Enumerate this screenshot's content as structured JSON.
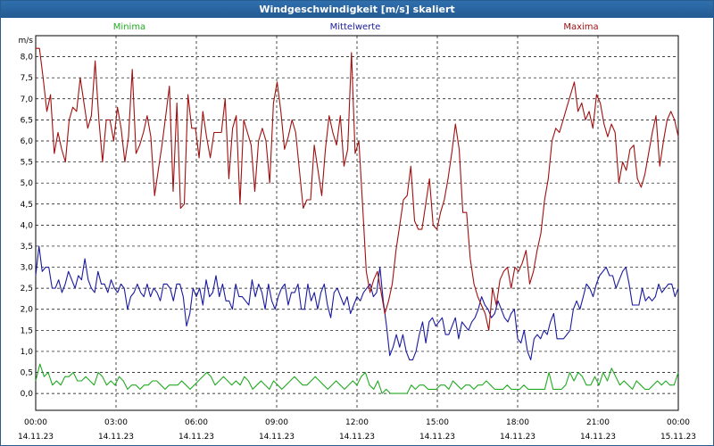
{
  "window": {
    "title": "Windgeschwindigkeit [m/s] skaliert"
  },
  "chart_data": {
    "type": "line",
    "title": "Windgeschwindigkeit [m/s] skaliert",
    "ylabel": "m/s",
    "ylim": [
      -0.4,
      8.5
    ],
    "xlim": [
      0,
      24
    ],
    "yticks": [
      "0,0",
      "0,5",
      "1,0",
      "1,5",
      "2,0",
      "2,5",
      "3,0",
      "3,5",
      "4,0",
      "4,5",
      "5,0",
      "5,5",
      "6,0",
      "6,5",
      "7,0",
      "7,5",
      "8,0"
    ],
    "xticks": [
      {
        "time": "00:00",
        "date": "14.11.23"
      },
      {
        "time": "03:00",
        "date": "14.11.23"
      },
      {
        "time": "06:00",
        "date": "14.11.23"
      },
      {
        "time": "09:00",
        "date": "14.11.23"
      },
      {
        "time": "12:00",
        "date": "14.11.23"
      },
      {
        "time": "15:00",
        "date": "14.11.23"
      },
      {
        "time": "18:00",
        "date": "14.11.23"
      },
      {
        "time": "21:00",
        "date": "14.11.23"
      },
      {
        "time": "00:00",
        "date": "15.11.23"
      }
    ],
    "grid": true,
    "legend_position": "top",
    "series": [
      {
        "name": "Minima",
        "color": "#22aa22",
        "values": [
          0.3,
          0.7,
          0.4,
          0.5,
          0.2,
          0.3,
          0.2,
          0.4,
          0.4,
          0.5,
          0.3,
          0.3,
          0.4,
          0.3,
          0.2,
          0.5,
          0.4,
          0.2,
          0.3,
          0.2,
          0.4,
          0.3,
          0.1,
          0.2,
          0.2,
          0.1,
          0.2,
          0.2,
          0.3,
          0.3,
          0.2,
          0.1,
          0.2,
          0.2,
          0.2,
          0.3,
          0.2,
          0.1,
          0.2,
          0.3,
          0.4,
          0.5,
          0.4,
          0.2,
          0.3,
          0.4,
          0.3,
          0.2,
          0.3,
          0.2,
          0.4,
          0.3,
          0.1,
          0.2,
          0.3,
          0.2,
          0.1,
          0.3,
          0.2,
          0.1,
          0.2,
          0.3,
          0.4,
          0.3,
          0.2,
          0.2,
          0.3,
          0.4,
          0.3,
          0.2,
          0.1,
          0.2,
          0.3,
          0.2,
          0.1,
          0.2,
          0.3,
          0.2,
          0.4,
          0.5,
          0.2,
          0.1,
          0.3,
          0.0,
          0.1,
          0.0,
          0.0,
          0.0,
          0.0,
          0.0,
          0.2,
          0.1,
          0.2,
          0.2,
          0.1,
          0.1,
          0.1,
          0.2,
          0.2,
          0.1,
          0.3,
          0.2,
          0.1,
          0.2,
          0.2,
          0.1,
          0.2,
          0.2,
          0.3,
          0.2,
          0.1,
          0.1,
          0.1,
          0.2,
          0.1,
          0.1,
          0.1,
          0.2,
          0.1,
          0.1,
          0.1,
          0.1,
          0.1,
          0.5,
          0.1,
          0.1,
          0.1,
          0.2,
          0.5,
          0.3,
          0.5,
          0.4,
          0.2,
          0.2,
          0.4,
          0.2,
          0.5,
          0.3,
          0.6,
          0.4,
          0.2,
          0.3,
          0.2,
          0.1,
          0.3,
          0.2,
          0.1,
          0.1,
          0.2,
          0.3,
          0.2,
          0.3,
          0.2,
          0.2,
          0.5
        ]
      },
      {
        "name": "Mittelwerte",
        "color": "#1a1aa0",
        "values": [
          2.8,
          3.5,
          2.9,
          3.0,
          3.0,
          2.5,
          2.5,
          2.7,
          2.4,
          2.6,
          2.9,
          2.7,
          2.5,
          2.8,
          2.7,
          3.2,
          2.7,
          2.5,
          2.4,
          2.9,
          2.6,
          2.6,
          2.4,
          2.7,
          2.5,
          2.4,
          2.6,
          2.5,
          2.0,
          2.3,
          2.4,
          2.6,
          2.4,
          2.3,
          2.6,
          2.3,
          2.5,
          2.4,
          2.2,
          2.6,
          2.6,
          2.5,
          2.2,
          2.6,
          2.6,
          2.3,
          1.6,
          1.9,
          2.5,
          2.3,
          2.5,
          2.1,
          2.7,
          2.3,
          2.4,
          2.8,
          2.3,
          2.6,
          2.2,
          2.2,
          2.0,
          2.6,
          2.3,
          2.3,
          2.2,
          2.1,
          2.7,
          2.3,
          2.6,
          2.4,
          2.0,
          2.6,
          2.2,
          2.0,
          2.3,
          2.5,
          2.6,
          2.1,
          2.4,
          2.4,
          2.6,
          2.0,
          2.0,
          2.6,
          2.2,
          2.4,
          2.0,
          2.4,
          2.6,
          2.1,
          1.8,
          2.4,
          2.5,
          2.3,
          2.1,
          2.3,
          1.9,
          2.1,
          2.3,
          2.2,
          2.4,
          2.5,
          2.6,
          2.3,
          2.4,
          3.0,
          2.2,
          1.6,
          0.9,
          1.1,
          1.4,
          1.1,
          1.4,
          1.0,
          0.8,
          0.8,
          1.0,
          1.4,
          1.7,
          1.2,
          1.7,
          1.8,
          1.6,
          1.7,
          1.8,
          1.4,
          1.4,
          1.6,
          1.8,
          1.3,
          1.7,
          1.6,
          1.5,
          1.7,
          1.8,
          2.0,
          2.3,
          2.1,
          2.0,
          1.8,
          1.9,
          2.2,
          2.0,
          1.8,
          1.7,
          1.9,
          2.0,
          1.3,
          1.2,
          1.5,
          1.0,
          0.8,
          1.3,
          1.4,
          1.3,
          1.5,
          1.4,
          1.7,
          1.9,
          1.3,
          1.3,
          1.3,
          1.4,
          1.5,
          2.0,
          2.2,
          2.0,
          2.3,
          2.6,
          2.5,
          2.3,
          2.6,
          2.8,
          2.9,
          3.0,
          2.8,
          2.8,
          2.5,
          2.7,
          2.9,
          3.0,
          2.6,
          2.1,
          2.1,
          2.1,
          2.5,
          2.2,
          2.3,
          2.2,
          2.3,
          2.6,
          2.4,
          2.5,
          2.6,
          2.6,
          2.3,
          2.5
        ]
      },
      {
        "name": "Maxima",
        "color": "#a01010",
        "values": [
          8.2,
          8.2,
          7.5,
          6.7,
          7.1,
          5.7,
          6.2,
          5.8,
          5.5,
          6.5,
          6.8,
          6.7,
          7.5,
          6.9,
          6.3,
          6.6,
          7.9,
          6.5,
          5.5,
          6.5,
          6.5,
          6.0,
          6.8,
          6.3,
          5.5,
          6.1,
          7.7,
          5.7,
          5.9,
          6.2,
          6.6,
          6.1,
          4.7,
          5.3,
          5.9,
          6.6,
          7.3,
          4.8,
          6.9,
          4.4,
          4.5,
          7.1,
          6.3,
          6.3,
          5.6,
          6.7,
          6.1,
          5.6,
          6.2,
          6.2,
          6.2,
          7.0,
          5.1,
          6.3,
          6.6,
          4.5,
          6.5,
          6.2,
          5.9,
          4.8,
          6.0,
          6.3,
          6.0,
          5.0,
          6.9,
          7.4,
          6.7,
          5.8,
          6.1,
          6.5,
          6.2,
          5.3,
          4.4,
          4.6,
          4.6,
          5.9,
          5.3,
          4.7,
          5.8,
          6.6,
          6.2,
          5.9,
          6.6,
          5.4,
          5.8,
          8.1,
          5.7,
          6.0,
          4.5,
          2.9,
          2.4,
          2.7,
          2.9,
          2.4,
          1.9,
          2.2,
          2.6,
          3.4,
          4.0,
          4.6,
          4.7,
          5.4,
          4.1,
          3.9,
          3.9,
          4.5,
          5.1,
          4.0,
          3.9,
          4.3,
          4.6,
          5.1,
          5.7,
          6.4,
          5.8,
          4.3,
          4.3,
          3.2,
          2.6,
          2.3,
          2.1,
          1.9,
          1.5,
          2.5,
          2.1,
          2.7,
          2.9,
          3.0,
          2.5,
          3.0,
          2.9,
          3.1,
          3.4,
          2.6,
          2.9,
          3.4,
          3.8,
          4.6,
          5.1,
          6.0,
          6.3,
          6.2,
          6.5,
          6.8,
          7.1,
          7.4,
          6.7,
          6.9,
          6.5,
          6.7,
          6.3,
          7.1,
          6.9,
          6.4,
          6.1,
          6.4,
          6.2,
          5.0,
          5.5,
          5.3,
          5.8,
          5.9,
          5.1,
          4.9,
          5.2,
          5.7,
          6.2,
          6.6,
          5.4,
          6.0,
          6.5,
          6.7,
          6.5,
          6.1
        ]
      }
    ]
  }
}
